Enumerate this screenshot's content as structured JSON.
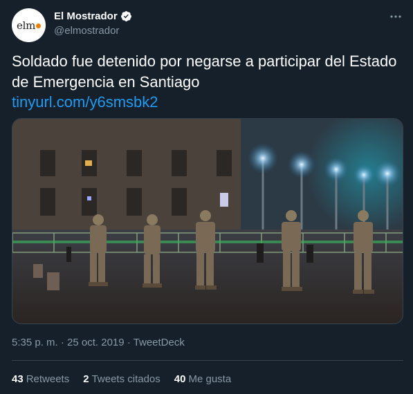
{
  "author": {
    "avatar_text": "elm",
    "name": "El Mostrador",
    "handle": "@elmostrador"
  },
  "tweet": {
    "text": "Soldado fue detenido por negarse a participar del Estado de Emergencia en Santiago",
    "link": "tinyurl.com/y6smsbk2",
    "timestamp": "5:35 p. m. · 25 oct. 2019 · TweetDeck"
  },
  "stats": {
    "retweets_count": "43",
    "retweets_label": "Retweets",
    "quotes_count": "2",
    "quotes_label": "Tweets citados",
    "likes_count": "40",
    "likes_label": "Me gusta"
  },
  "icons": {
    "verified": "verified-badge-icon",
    "more": "more-options-icon"
  },
  "colors": {
    "background": "#15202b",
    "link": "#1d9bf0",
    "secondary_text": "#8899a6",
    "divider": "#38444d",
    "avatar_accent": "#ef7d00"
  }
}
